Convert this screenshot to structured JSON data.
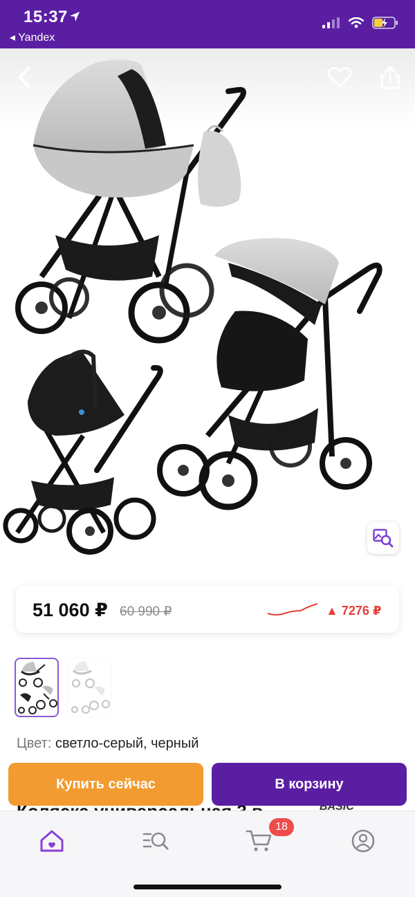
{
  "status_bar": {
    "time": "15:37",
    "back_app": "◂ Yandex",
    "bg_color": "#5a1ea3"
  },
  "hero": {
    "icons": [
      "back-chevron-icon",
      "heart-icon",
      "share-icon",
      "image-search-icon"
    ]
  },
  "price": {
    "current": "51 060 ₽",
    "old": "60 990 ₽",
    "delta": "▲ 7276 ₽",
    "delta_color": "#e5403a"
  },
  "color_option": {
    "label": "Цвет:",
    "value": "светло-серый, черный"
  },
  "actions": {
    "buy_now": "Купить сейчас",
    "add_to_cart": "В корзину",
    "buy_color": "#f29b30",
    "cart_color": "#5a1ea3"
  },
  "product": {
    "title_peek": "Коляска универсальная 3 в",
    "brand_peek": "BASIC"
  },
  "tabbar": {
    "cart_count": "18",
    "active_color": "#8b3fd9",
    "items": [
      "home-icon",
      "catalog-search-icon",
      "cart-icon",
      "profile-icon"
    ]
  }
}
